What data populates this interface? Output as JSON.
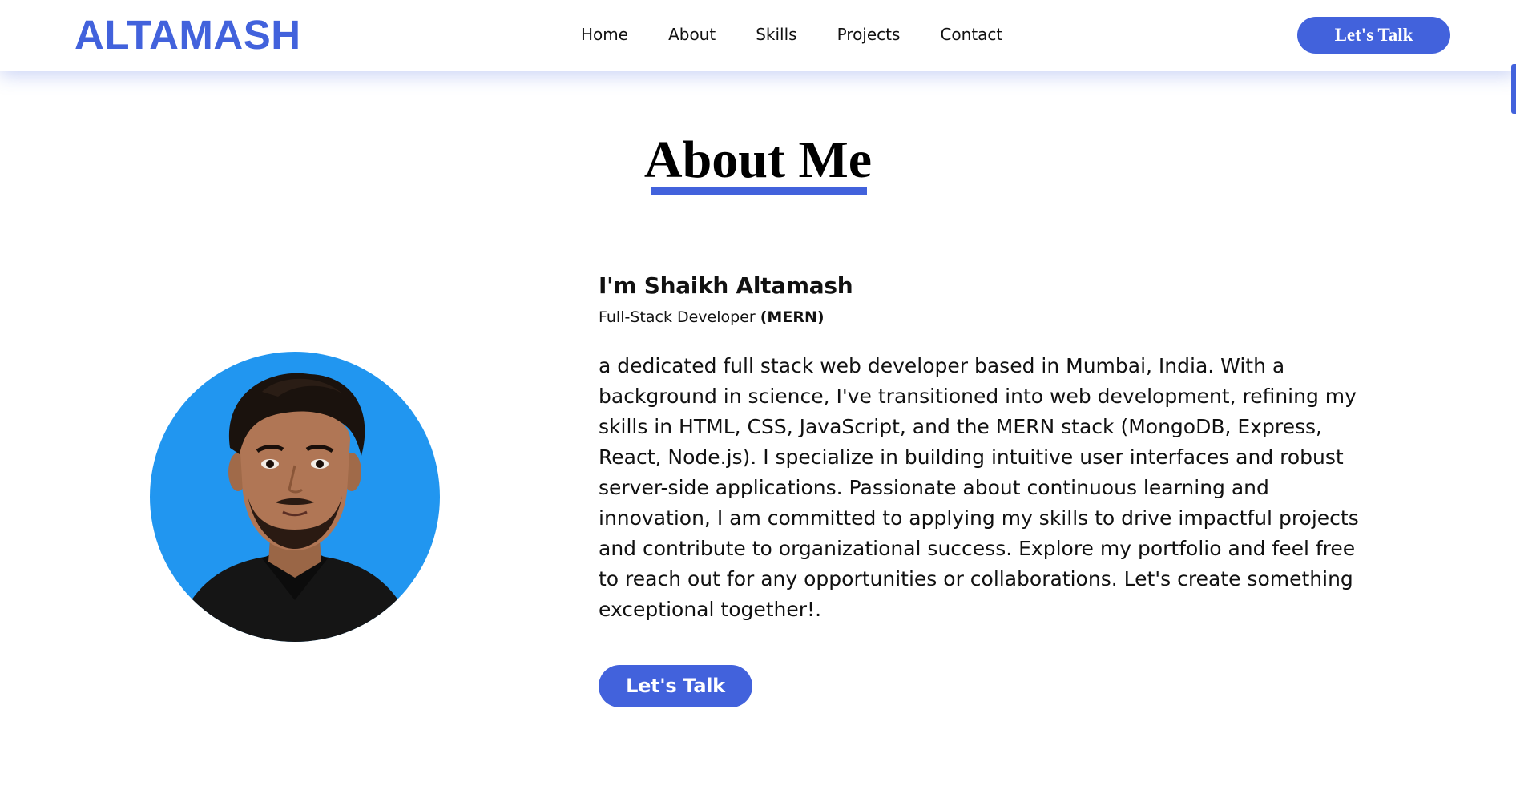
{
  "header": {
    "logo": "ALTAMASH",
    "nav": [
      {
        "label": "Home"
      },
      {
        "label": "About"
      },
      {
        "label": "Skills"
      },
      {
        "label": "Projects"
      },
      {
        "label": "Contact"
      }
    ],
    "cta_label": "Let's Talk"
  },
  "about": {
    "title": "About Me",
    "name": "I'm Shaikh Altamash",
    "role_prefix": "Full-Stack Developer ",
    "role_stack": "(MERN)",
    "bio": "a dedicated full stack web developer based in Mumbai, India. With a background in science, I've transitioned into web development, refining my skills in HTML, CSS, JavaScript, and the MERN stack (MongoDB, Express, React, Node.js). I specialize in building intuitive user interfaces and robust server-side applications. Passionate about continuous learning and innovation, I am committed to applying my skills to drive impactful projects and contribute to organizational success. Explore my portfolio and feel free to reach out for any opportunities or collaborations. Let's create something exceptional together!.",
    "cta_label": "Let's Talk"
  },
  "colors": {
    "accent": "#4262dc",
    "avatar_background": "#2196f0",
    "text": "#111111"
  },
  "icons": {
    "avatar": "profile-photo"
  }
}
